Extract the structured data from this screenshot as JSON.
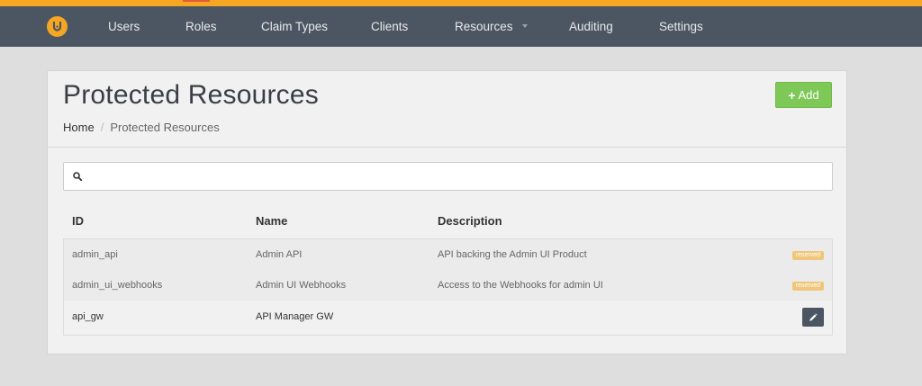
{
  "navbar": {
    "items": [
      {
        "label": "Users"
      },
      {
        "label": "Roles"
      },
      {
        "label": "Claim Types"
      },
      {
        "label": "Clients"
      },
      {
        "label": "Resources"
      },
      {
        "label": "Auditing"
      },
      {
        "label": "Settings"
      }
    ]
  },
  "page": {
    "title": "Protected Resources",
    "add_label": "Add",
    "breadcrumb": {
      "home": "Home",
      "current": "Protected Resources",
      "separator": "/"
    }
  },
  "search": {
    "placeholder": "",
    "value": ""
  },
  "table": {
    "columns": [
      "ID",
      "Name",
      "Description"
    ],
    "rows": [
      {
        "id": "admin_api",
        "name": "Admin API",
        "description": "API backing the Admin UI Product",
        "badge": "reserved"
      },
      {
        "id": "admin_ui_webhooks",
        "name": "Admin UI Webhooks",
        "description": "Access to the Webhooks for admin UI",
        "badge": "reserved"
      },
      {
        "id": "api_gw",
        "name": "API Manager GW",
        "description": ""
      }
    ]
  },
  "colors": {
    "accent": "#f5a623",
    "navbar": "#4c5662",
    "add_button": "#7dc857",
    "badge": "#f0c77a"
  },
  "icons": [
    "logo-icon",
    "chevron-down-icon",
    "plus-icon",
    "search-icon",
    "pencil-icon"
  ]
}
